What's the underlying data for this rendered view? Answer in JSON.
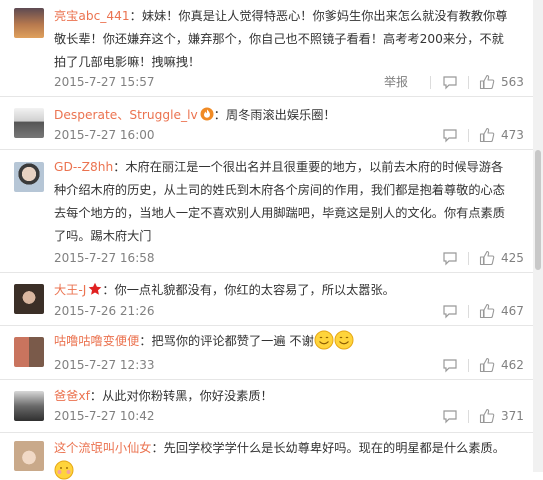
{
  "comments": [
    {
      "user": "亮宝abc_441",
      "text": "：妹妹！你真是让人觉得特恶心！你爹妈生你出来怎么就没有教教你尊敬长辈！你还嫌弃这个，嫌弃那个，你自己也不照镜子看看！高考考200来分，不就拍了几部电影嘛！拽嘛拽！",
      "time": "2015-7-27 15:57",
      "report": "举报",
      "likes": "563",
      "avatar_color": "#c58a5b"
    },
    {
      "user": "Desperate、Struggle_lv",
      "badge": "fire-badge-icon",
      "text": "：周冬雨滚出娱乐圈！",
      "time": "2015-7-27 16:00",
      "likes": "473",
      "avatar_color": "#8c8c8c"
    },
    {
      "user": "GD--Z8hh",
      "text": "：木府在丽江是一个很出名并且很重要的地方，以前去木府的时候导游各种介绍木府的历史，从土司的姓氏到木府各个房间的作用，我们都是抱着尊敬的心态去每个地方的，当地人一定不喜欢别人用脚踹吧，毕竟这是别人的文化。你有点素质了吗。踢木府大门",
      "time": "2015-7-27 16:58",
      "likes": "425",
      "avatar_color": "#9fb1c4"
    },
    {
      "user": "大王-J",
      "badge": "star-badge-icon",
      "text": "：你一点礼貌都没有，你红的太容易了，所以太嚣张。",
      "time": "2015-7-26 21:26",
      "likes": "467",
      "avatar_color": "#6b5646"
    },
    {
      "user": "咕噜咕噜变便便",
      "text": "：把骂你的评论都赞了一遍 不谢",
      "emoji": "smile-emoji-icon",
      "time": "2015-7-27 12:33",
      "likes": "462",
      "avatar_color": "#a7543f"
    },
    {
      "user": "爸爸xf",
      "text": "：从此对你粉转黑，你好没素质！",
      "time": "2015-7-27 10:42",
      "likes": "371",
      "avatar_color": "#7a7a7a"
    },
    {
      "user": "这个流氓叫小仙女",
      "text": "：先回学校学学什么是长幼尊卑好吗。现在的明星都是什么素质。",
      "avatar_color": "#d9c2a8"
    }
  ],
  "colors": {
    "username": "#eb7350",
    "meta": "#808080"
  }
}
